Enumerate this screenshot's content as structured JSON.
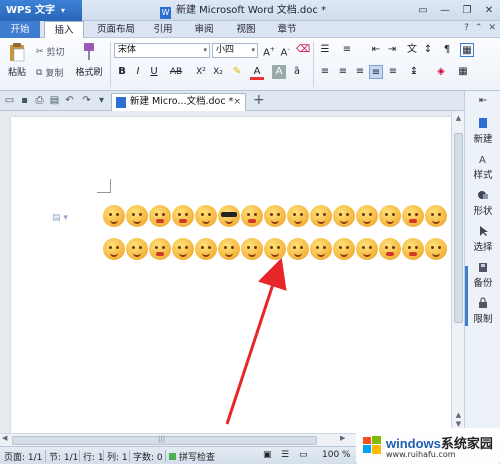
{
  "app": {
    "name": "WPS 文字",
    "title": "新建 Microsoft Word 文档.doc *"
  },
  "menu": {
    "tabs": [
      "开始",
      "插入",
      "页面布局",
      "引用",
      "审阅",
      "视图",
      "章节"
    ]
  },
  "ribbon": {
    "paste_label": "粘贴",
    "cut_label": "剪切",
    "copy_label": "复制",
    "format_painter_label": "格式刷",
    "font_name": "宋体",
    "font_size": "小四"
  },
  "doc_tab": {
    "label": "新建 Micro...文档.doc *"
  },
  "taskpane": {
    "items": [
      "新建",
      "样式",
      "形状",
      "选择",
      "备份",
      "限制"
    ]
  },
  "status": {
    "page": "页面: 1/1",
    "section": "节: 1/1",
    "row": "行: 1",
    "col": "列: 1",
    "chars": "字数: 0",
    "spell": "拼写检查",
    "zoom": "100 %"
  },
  "watermark": {
    "line1_a": "windows",
    "line1_b": "系统家园",
    "line2": "www.ruihafu.com"
  },
  "colors": {
    "accent": "#3e7dd0",
    "arrow": "#e8262a",
    "emoji": "#f4b23a"
  }
}
